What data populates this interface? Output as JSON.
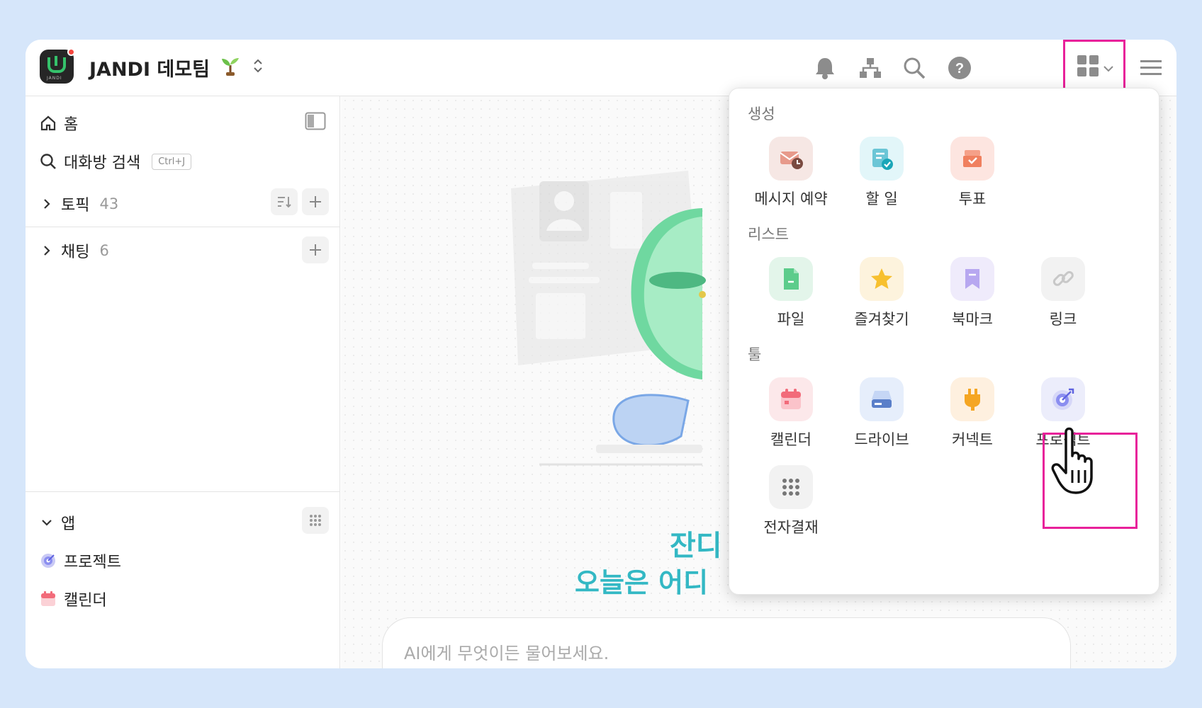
{
  "header": {
    "team_name": "JANDI 데모팀",
    "logo_text": "JANDI",
    "icons": [
      "bell-icon",
      "org-chart-icon",
      "search-icon",
      "help-icon",
      "apps-grid-icon",
      "hamburger-menu-icon"
    ]
  },
  "sidebar": {
    "home_label": "홈",
    "search_label": "대화방 검색",
    "search_shortcut": "Ctrl+J",
    "topics_label": "토픽",
    "topics_count": "43",
    "chats_label": "채팅",
    "chats_count": "6",
    "apps_label": "앱",
    "app_items": [
      {
        "label": "프로젝트",
        "icon": "project-target-icon"
      },
      {
        "label": "캘린더",
        "icon": "calendar-icon"
      }
    ]
  },
  "main": {
    "greeting_line1": "잔디",
    "greeting_line2": "오늘은 어디",
    "ai_placeholder": "AI에게 무엇이든 물어보세요."
  },
  "apps_panel": {
    "sections": [
      {
        "title": "생성",
        "items": [
          {
            "label": "메시지 예약",
            "icon": "scheduled-message-icon",
            "color": "#f6e7e4"
          },
          {
            "label": "할 일",
            "icon": "todo-icon",
            "color": "#e2f6f9"
          },
          {
            "label": "투표",
            "icon": "vote-icon",
            "color": "#fde5e0"
          }
        ]
      },
      {
        "title": "리스트",
        "items": [
          {
            "label": "파일",
            "icon": "file-icon",
            "color": "#e3f5ea"
          },
          {
            "label": "즐겨찾기",
            "icon": "star-icon",
            "color": "#fdf3dd"
          },
          {
            "label": "북마크",
            "icon": "bookmark-icon",
            "color": "#efebfb"
          },
          {
            "label": "링크",
            "icon": "link-icon",
            "color": "#f2f2f2"
          }
        ]
      },
      {
        "title": "툴",
        "items": [
          {
            "label": "캘린더",
            "icon": "calendar-icon",
            "color": "#fce8ea"
          },
          {
            "label": "드라이브",
            "icon": "drive-icon",
            "color": "#e6eefb"
          },
          {
            "label": "커넥트",
            "icon": "connect-plug-icon",
            "color": "#fef0df"
          },
          {
            "label": "프로젝트",
            "icon": "project-target-icon",
            "color": "#ecedfb"
          },
          {
            "label": "전자결재",
            "icon": "dots-grid-icon",
            "color": "#f2f2f2"
          }
        ]
      }
    ]
  }
}
